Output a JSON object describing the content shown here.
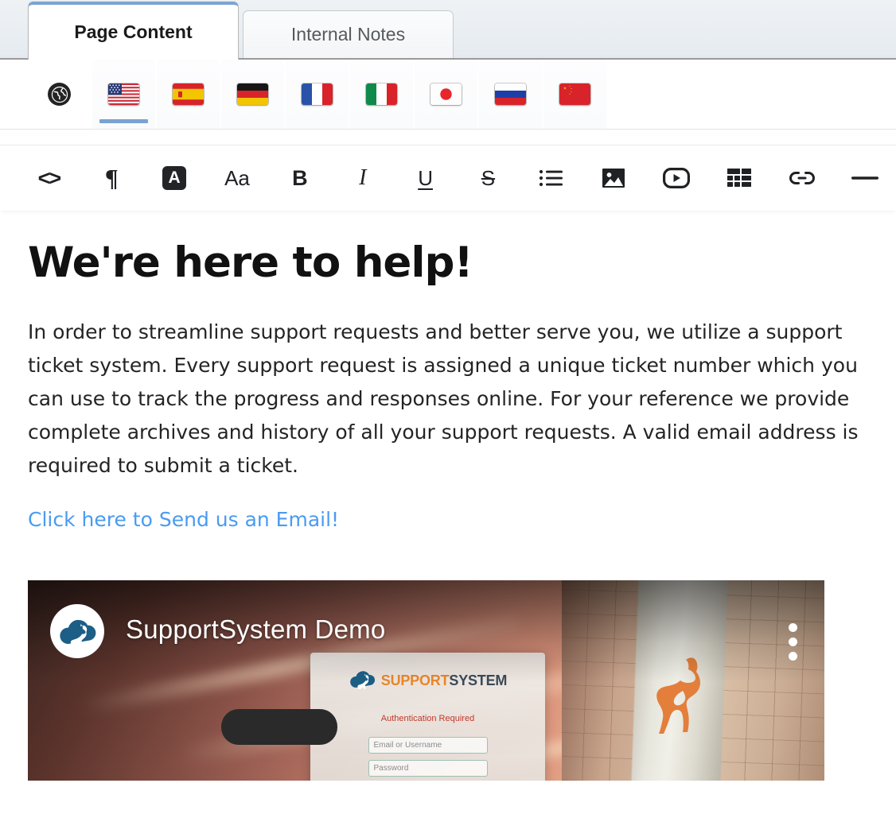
{
  "tabs": [
    {
      "label": "Page Content",
      "active": true
    },
    {
      "label": "Internal Notes",
      "active": false
    }
  ],
  "language_bar": {
    "items": [
      {
        "name": "globe",
        "label": "All Languages",
        "icon": "globe-icon",
        "selected": false
      },
      {
        "name": "us",
        "label": "English (US)",
        "icon": "flag-us",
        "selected": true
      },
      {
        "name": "es",
        "label": "Spanish",
        "icon": "flag-es",
        "selected": false
      },
      {
        "name": "de",
        "label": "German",
        "icon": "flag-de",
        "selected": false
      },
      {
        "name": "fr",
        "label": "French",
        "icon": "flag-fr",
        "selected": false
      },
      {
        "name": "it",
        "label": "Italian",
        "icon": "flag-it",
        "selected": false
      },
      {
        "name": "jp",
        "label": "Japanese",
        "icon": "flag-jp",
        "selected": false
      },
      {
        "name": "ru",
        "label": "Russian",
        "icon": "flag-ru",
        "selected": false
      },
      {
        "name": "cn",
        "label": "Chinese",
        "icon": "flag-cn",
        "selected": false
      }
    ]
  },
  "toolbar": {
    "buttons": [
      {
        "name": "source-code-button",
        "icon": "code-icon",
        "glyph": "<>"
      },
      {
        "name": "paragraph-format-button",
        "icon": "pilcrow-icon",
        "glyph": "¶"
      },
      {
        "name": "text-color-button",
        "icon": "text-color-icon",
        "glyph": "A"
      },
      {
        "name": "font-size-button",
        "icon": "font-size-icon",
        "glyph": "Aa"
      },
      {
        "name": "bold-button",
        "icon": "bold-icon",
        "glyph": "B"
      },
      {
        "name": "italic-button",
        "icon": "italic-icon",
        "glyph": "I"
      },
      {
        "name": "underline-button",
        "icon": "underline-icon",
        "glyph": "U"
      },
      {
        "name": "strikethrough-button",
        "icon": "strikethrough-icon",
        "glyph": "S"
      },
      {
        "name": "unordered-list-button",
        "icon": "bullet-list-icon",
        "glyph": ""
      },
      {
        "name": "insert-image-button",
        "icon": "image-icon",
        "glyph": ""
      },
      {
        "name": "insert-video-button",
        "icon": "video-icon",
        "glyph": ""
      },
      {
        "name": "insert-table-button",
        "icon": "table-icon",
        "glyph": ""
      },
      {
        "name": "insert-link-button",
        "icon": "link-icon",
        "glyph": ""
      },
      {
        "name": "horizontal-rule-button",
        "icon": "horizontal-rule-icon",
        "glyph": "—"
      }
    ]
  },
  "document": {
    "heading": "We're here to help!",
    "paragraph": "In order to streamline support requests and better serve you, we utilize a support ticket system. Every support request is assigned a unique ticket number which you can use to track the progress and responses online. For your reference we provide complete archives and history of all your support requests. A valid email address is required to submit a ticket.",
    "link_text": "Click here to Send us an Email!",
    "link_color": "#4a9bf0"
  },
  "video": {
    "title": "SupportSystem Demo",
    "channel_avatar_icon": "kangaroo-cloud-logo",
    "menu_icon": "kebab-menu-icon",
    "thumbnail": {
      "logo_part_one": "SUPPORT",
      "logo_part_two": "SYSTEM",
      "status_text": "Authentication Required",
      "status_color": "#c0392b",
      "field_one_placeholder": "Email or Username",
      "field_two_placeholder": "Password"
    }
  },
  "colors": {
    "accent_blue": "#7aa5d2",
    "tabstrip_bg": "#e9eef2",
    "toolbar_fg": "#202124",
    "link": "#4a9bf0"
  }
}
